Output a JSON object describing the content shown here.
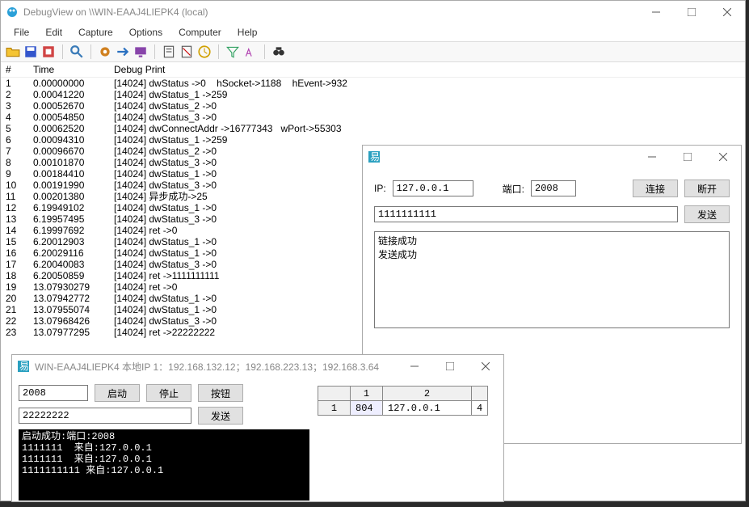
{
  "debugview": {
    "title": "DebugView on \\\\WIN-EAAJ4LIEPK4 (local)",
    "menus": [
      "File",
      "Edit",
      "Capture",
      "Options",
      "Computer",
      "Help"
    ],
    "columns": {
      "num": "#",
      "time": "Time",
      "debug": "Debug Print"
    },
    "rows": [
      {
        "n": "1",
        "t": "0.00000000",
        "d": "[14024] dwStatus ->0    hSocket->1188    hEvent->932"
      },
      {
        "n": "2",
        "t": "0.00041220",
        "d": "[14024] dwStatus_1 ->259"
      },
      {
        "n": "3",
        "t": "0.00052670",
        "d": "[14024] dwStatus_2 ->0"
      },
      {
        "n": "4",
        "t": "0.00054850",
        "d": "[14024] dwStatus_3 ->0"
      },
      {
        "n": "5",
        "t": "0.00062520",
        "d": "[14024] dwConnectAddr ->16777343   wPort->55303"
      },
      {
        "n": "6",
        "t": "0.00094310",
        "d": "[14024] dwStatus_1 ->259"
      },
      {
        "n": "7",
        "t": "0.00096670",
        "d": "[14024] dwStatus_2 ->0"
      },
      {
        "n": "8",
        "t": "0.00101870",
        "d": "[14024] dwStatus_3 ->0"
      },
      {
        "n": "9",
        "t": "0.00184410",
        "d": "[14024] dwStatus_1 ->0"
      },
      {
        "n": "10",
        "t": "0.00191990",
        "d": "[14024] dwStatus_3 ->0"
      },
      {
        "n": "11",
        "t": "0.00201380",
        "d": "[14024] 异步成功->25"
      },
      {
        "n": "12",
        "t": "6.19949102",
        "d": "[14024] dwStatus_1 ->0"
      },
      {
        "n": "13",
        "t": "6.19957495",
        "d": "[14024] dwStatus_3 ->0"
      },
      {
        "n": "14",
        "t": "6.19997692",
        "d": "[14024] ret ->0"
      },
      {
        "n": "15",
        "t": "6.20012903",
        "d": "[14024] dwStatus_1 ->0"
      },
      {
        "n": "16",
        "t": "6.20029116",
        "d": "[14024] dwStatus_1 ->0"
      },
      {
        "n": "17",
        "t": "6.20040083",
        "d": "[14024] dwStatus_3 ->0"
      },
      {
        "n": "18",
        "t": "6.20050859",
        "d": "[14024] ret ->1111111111"
      },
      {
        "n": "19",
        "t": "13.07930279",
        "d": "[14024] ret ->0"
      },
      {
        "n": "20",
        "t": "13.07942772",
        "d": "[14024] dwStatus_1 ->0"
      },
      {
        "n": "21",
        "t": "13.07955074",
        "d": "[14024] dwStatus_1 ->0"
      },
      {
        "n": "22",
        "t": "13.07968426",
        "d": "[14024] dwStatus_3 ->0"
      },
      {
        "n": "23",
        "t": "13.07977295",
        "d": "[14024] ret ->22222222"
      }
    ]
  },
  "client": {
    "ip_label": "IP:",
    "ip_value": "127.0.0.1",
    "port_label": "端口:",
    "port_value": "2008",
    "btn_connect": "连接",
    "btn_disconnect": "断开",
    "msg_value": "1111111111",
    "btn_send": "发送",
    "log": "链接成功\n发送成功"
  },
  "server": {
    "title": "WIN-EAAJ4LIEPK4 本地IP 1：192.168.132.12；192.168.223.13；192.168.3.64",
    "port_value": "2008",
    "btn_start": "启动",
    "btn_stop": "停止",
    "btn_button": "按钮",
    "msg_value": "22222222",
    "btn_send": "发送",
    "console": "启动成功:端口:2008\n1111111  来自:127.0.0.1\n1111111  来自:127.0.0.1\n1111111111 来自:127.0.0.1",
    "table": {
      "headers": [
        "",
        "1",
        "2",
        ""
      ],
      "row": [
        "1",
        "804",
        "127.0.0.1",
        "4"
      ]
    }
  }
}
